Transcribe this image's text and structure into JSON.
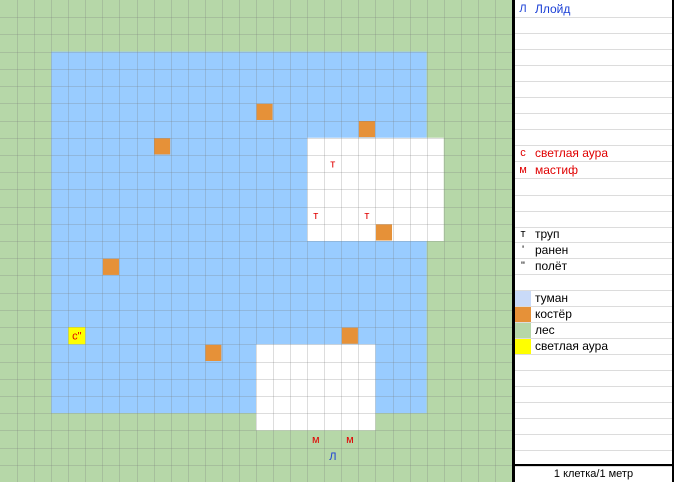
{
  "colors": {
    "forest": "#b6d7a8",
    "fog": "#99ccff",
    "clear": "#ffffff",
    "campfire": "#e69138",
    "light_aura": "#ffff00",
    "enemy_text": "#e00000",
    "player_text": "#1a3fd6",
    "grid": "rgba(120,120,120,0.25)"
  },
  "map": {
    "cols": 30,
    "rows": 28,
    "fog_rect": [
      3,
      3,
      24,
      23
    ],
    "clear_areas": [
      [
        18,
        8,
        25,
        13
      ],
      [
        15,
        20,
        21,
        24
      ]
    ],
    "campfires": [
      [
        15,
        6
      ],
      [
        21,
        7
      ],
      [
        9,
        8
      ],
      [
        22,
        13
      ],
      [
        6,
        15
      ],
      [
        20,
        19
      ],
      [
        12,
        20
      ]
    ],
    "auras": [
      [
        4,
        19
      ]
    ],
    "markers": [
      {
        "col": 19,
        "row": 9,
        "text": "т",
        "color": "#e00000"
      },
      {
        "col": 18,
        "row": 12,
        "text": "т",
        "color": "#e00000"
      },
      {
        "col": 21,
        "row": 12,
        "text": "т",
        "color": "#e00000"
      },
      {
        "col": 4,
        "row": 19,
        "text": "с\"",
        "color": "#e00000"
      },
      {
        "col": 18,
        "row": 25,
        "text": "м",
        "color": "#e00000"
      },
      {
        "col": 20,
        "row": 25,
        "text": "м",
        "color": "#e00000"
      },
      {
        "col": 19,
        "row": 26,
        "text": "Л",
        "color": "#1a3fd6"
      }
    ]
  },
  "legend": {
    "player": {
      "code": "Л",
      "label": "Ллойд"
    },
    "creatures": [
      {
        "code": "с",
        "label": "светлая аура"
      },
      {
        "code": "м",
        "label": "мастиф"
      }
    ],
    "statuses": [
      {
        "code": "т",
        "label": "труп"
      },
      {
        "code": "'",
        "label": "ранен"
      },
      {
        "code": "\"",
        "label": "полёт"
      }
    ],
    "terrain": [
      {
        "swatch": "fog",
        "label": "туман"
      },
      {
        "swatch": "campfire",
        "label": "костёр"
      },
      {
        "swatch": "forest",
        "label": "лес"
      },
      {
        "swatch": "light_aura",
        "label": "светлая аура"
      }
    ],
    "scale": "1 клетка/1 метр"
  }
}
